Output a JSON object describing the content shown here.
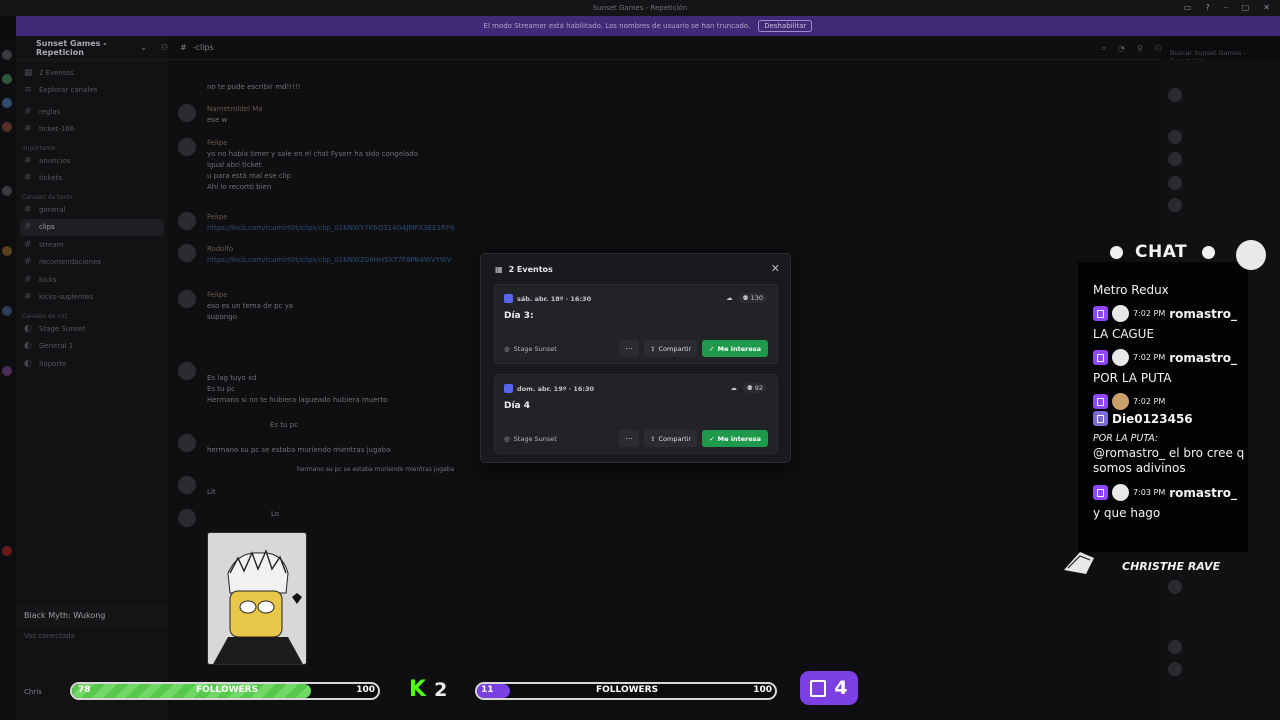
{
  "window": {
    "title": "Sunset Games - Repetición"
  },
  "banner": {
    "text": "El modo Streamer está habilitado. Los nombres de usuario se han truncado.",
    "button": "Deshabilitar"
  },
  "sidebar": {
    "server_name": "Sunset Games - Repeticion",
    "top_items": [
      "2 Eventos",
      "Explorar canales"
    ],
    "items_a": [
      "reglas",
      "ticket-166"
    ],
    "cat_1": "importante",
    "items_b": [
      "anuncios",
      "tickets"
    ],
    "cat_2": "Canales de texto",
    "items_c": [
      "general",
      "clips",
      "stream",
      "recomendaciones",
      "kicks",
      "kicks-suplentes"
    ],
    "cat_3": "Canales de voz",
    "items_d": [
      "Stage Sunset",
      "General 1",
      "Soporte"
    ],
    "game": "Black Myth: Wukong",
    "voice_status": "Voz conectada",
    "user": "Chris"
  },
  "chat": {
    "channel": "-clips",
    "search_placeholder": "Buscar Sunset Games - Repetición",
    "messages": [
      {
        "text": "no te pude escribir md!!!!!"
      },
      {
        "author": "Nametroldel Ma",
        "text": "ese w"
      },
      {
        "author": "Felipe",
        "text": "yo no había timer y sale en el chat Fyserr ha sido congelado"
      },
      {
        "text": "igual abrí ticket"
      },
      {
        "text": "u para está mal ese clip"
      },
      {
        "text": "Ahí lo recortó bien"
      },
      {
        "author": "Felipe",
        "text": "https://kick.com/rcamirt0t/clips/clip_01KNWY7K6Q314G4JMFX3EE1RF6"
      },
      {
        "author": "Rodolfo",
        "text": "https://kick.com/rcamirt0t/clips/clip_01KNWZ06HH5XT7F8PB4WVYWV"
      },
      {
        "author": "Felipe",
        "text": "eso es un tema de pc ya"
      },
      {
        "text": "supongo"
      },
      {
        "text": "Es lag tuyo xd"
      },
      {
        "text": "Es tu pc"
      },
      {
        "text": "Hermano si no te hubiera lagueado hubiera muerto"
      },
      {
        "text": "Es tu pc"
      },
      {
        "text": "hermano su pc se estaba muriendo mientras jugaba"
      },
      {
        "text": "hermano su pc se estaba muriendo mientras jugaba"
      },
      {
        "text": "Lit"
      },
      {
        "text": "Lo"
      }
    ]
  },
  "modal": {
    "title": "2 Eventos",
    "events": [
      {
        "date": "sáb. abr. 18º · 16:30",
        "name": "Día 3:",
        "count": "130",
        "location": "Stage Sunset",
        "share": "Compartir",
        "interest": "Me interesa"
      },
      {
        "date": "dom. abr. 19º · 16:30",
        "name": "Día 4",
        "count": "92",
        "location": "Stage Sunset",
        "share": "Compartir",
        "interest": "Me interesa"
      }
    ]
  },
  "stream_chat": {
    "header": "CHAT",
    "first_line": "Metro Redux",
    "rows": [
      {
        "time": "7:02 PM",
        "user": "romastro_",
        "body": "LA CAGUE"
      },
      {
        "time": "7:02 PM",
        "user": "romastro_",
        "body": "POR LA PUTA"
      },
      {
        "time": "7:02 PM",
        "user": "Die0123456",
        "reply": "POR LA PUTA:",
        "body": "@romastro_ el bro cree q somos adivinos"
      },
      {
        "time": "7:03 PM",
        "user": "romastro_",
        "body": "y que hago"
      }
    ],
    "footer_name": "CHRISTHE RAVE"
  },
  "followers": {
    "left": {
      "current": "78",
      "goal": "100",
      "label": "FOLLOWERS",
      "progress": 0.78,
      "color": "#57c84b"
    },
    "kick_count": "2",
    "right": {
      "current": "11",
      "goal": "100",
      "label": "FOLLOWERS",
      "progress": 0.11,
      "color": "#7b3fe4"
    },
    "twitch_count": "4"
  },
  "colors": {
    "accent": "#5865f2",
    "interest": "#1f9a4d",
    "twitch": "#9146ff",
    "kick": "#53fc18"
  }
}
